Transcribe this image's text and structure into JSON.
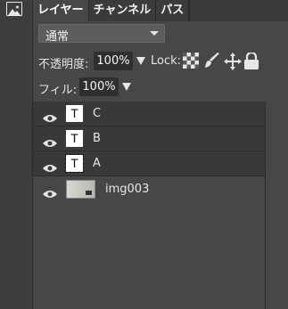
{
  "tabs": [
    {
      "label": "レイヤー",
      "active": true
    },
    {
      "label": "チャンネル",
      "active": false
    },
    {
      "label": "パス",
      "active": false
    }
  ],
  "blend_mode": {
    "value": "通常"
  },
  "opacity": {
    "label": "不透明度:",
    "value": "100%"
  },
  "lock": {
    "label": "Lock:"
  },
  "fill": {
    "label": "フィル:",
    "value": "100%"
  },
  "layers": [
    {
      "name": "C",
      "type": "text",
      "visible": true,
      "selected": false
    },
    {
      "name": "B",
      "type": "text",
      "visible": true,
      "selected": false
    },
    {
      "name": "A",
      "type": "text",
      "visible": true,
      "selected": true
    },
    {
      "name": "img003",
      "type": "image",
      "visible": true,
      "selected": false
    }
  ],
  "icons": {
    "left": "image-icon",
    "lock_options": [
      "lock-transparency-icon",
      "lock-paint-icon",
      "lock-move-icon",
      "lock-all-icon"
    ],
    "layer_visibility": "eye-icon"
  },
  "colors": {
    "panel_bg": "#474747",
    "tab_bar": "#2f2f2f",
    "row_bg": "#393939"
  }
}
